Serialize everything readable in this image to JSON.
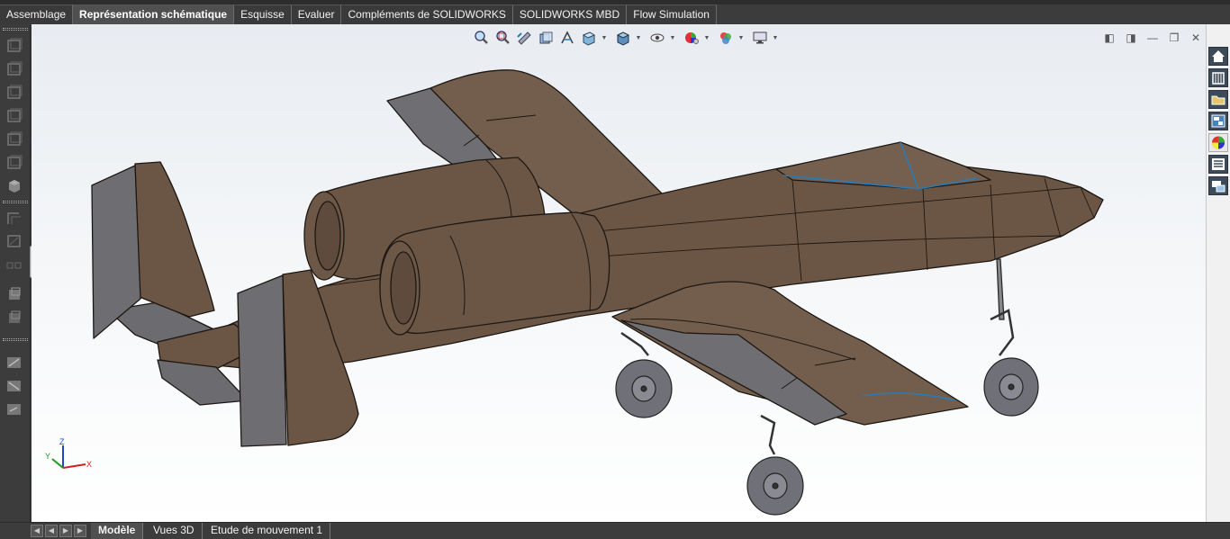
{
  "command_tabs": [
    {
      "label": "Assemblage",
      "active": false
    },
    {
      "label": "Représentation schématique",
      "active": true
    },
    {
      "label": "Esquisse",
      "active": false
    },
    {
      "label": "Evaluer",
      "active": false
    },
    {
      "label": "Compléments de SOLIDWORKS",
      "active": false
    },
    {
      "label": "SOLIDWORKS MBD",
      "active": false
    },
    {
      "label": "Flow Simulation",
      "active": false
    }
  ],
  "headsup_icons": [
    "zoom-to-fit-icon",
    "zoom-to-area-icon",
    "previous-view-icon",
    "section-view-icon",
    "dynamic-annotation-icon",
    "view-orientation-icon",
    "display-style-icon",
    "hide-show-icon",
    "edit-appearance-icon",
    "apply-scene-icon",
    "view-settings-icon"
  ],
  "task_pane_icons": [
    "home-icon",
    "resources-icon",
    "design-library-icon",
    "file-explorer-icon",
    "appearances-icon",
    "custom-properties-icon",
    "forum-icon"
  ],
  "bottom_tabs": [
    {
      "label": "Modèle",
      "active": true
    },
    {
      "label": "Vues 3D",
      "active": false
    },
    {
      "label": "Etude de mouvement 1",
      "active": false
    }
  ],
  "triad": {
    "x_label": "X",
    "y_label": "Y",
    "z_label": "Z"
  },
  "colors": {
    "model_body": "#6b5646",
    "model_grey": "#6e6e72",
    "accent_blue": "#2a7ab8",
    "toolbar_dark": "#3c3c3c"
  }
}
